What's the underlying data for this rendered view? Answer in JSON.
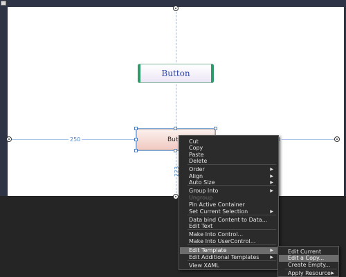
{
  "artboard": {
    "top_button_label": "Button",
    "selected_button_label": "Button",
    "dim_left": "250",
    "dim_right": "0",
    "dim_vertical": "223"
  },
  "context_menu": {
    "items": [
      {
        "label": "Cut",
        "submenu": false,
        "disabled": false
      },
      {
        "label": "Copy",
        "submenu": false,
        "disabled": false
      },
      {
        "label": "Paste",
        "submenu": false,
        "disabled": false
      },
      {
        "label": "Delete",
        "submenu": false,
        "disabled": false
      },
      {
        "label": "Order",
        "submenu": true,
        "disabled": false
      },
      {
        "label": "Align",
        "submenu": true,
        "disabled": false
      },
      {
        "label": "Auto Size",
        "submenu": true,
        "disabled": false
      },
      {
        "label": "Group Into",
        "submenu": true,
        "disabled": false
      },
      {
        "label": "Ungroup",
        "submenu": false,
        "disabled": true
      },
      {
        "label": "Pin Active Container",
        "submenu": false,
        "disabled": false
      },
      {
        "label": "Set Current Selection",
        "submenu": true,
        "disabled": false
      },
      {
        "label": "Data bind Content to Data...",
        "submenu": false,
        "disabled": false
      },
      {
        "label": "Edit Text",
        "submenu": false,
        "disabled": false
      },
      {
        "label": "Make Into Control...",
        "submenu": false,
        "disabled": false
      },
      {
        "label": "Make Into UserControl...",
        "submenu": false,
        "disabled": false
      },
      {
        "label": "Edit Template",
        "submenu": true,
        "disabled": false,
        "highlighted": true
      },
      {
        "label": "Edit Additional Templates",
        "submenu": true,
        "disabled": false
      },
      {
        "label": "View XAML",
        "submenu": false,
        "disabled": false
      }
    ]
  },
  "template_submenu": {
    "items": [
      {
        "label": "Edit Current",
        "highlighted": false
      },
      {
        "label": "Edit a Copy...",
        "highlighted": true
      },
      {
        "label": "Create Empty...",
        "highlighted": false
      },
      {
        "label": "Apply Resource",
        "highlighted": false,
        "submenu": true
      }
    ]
  },
  "icons": {
    "submenu_arrow": "▶"
  }
}
